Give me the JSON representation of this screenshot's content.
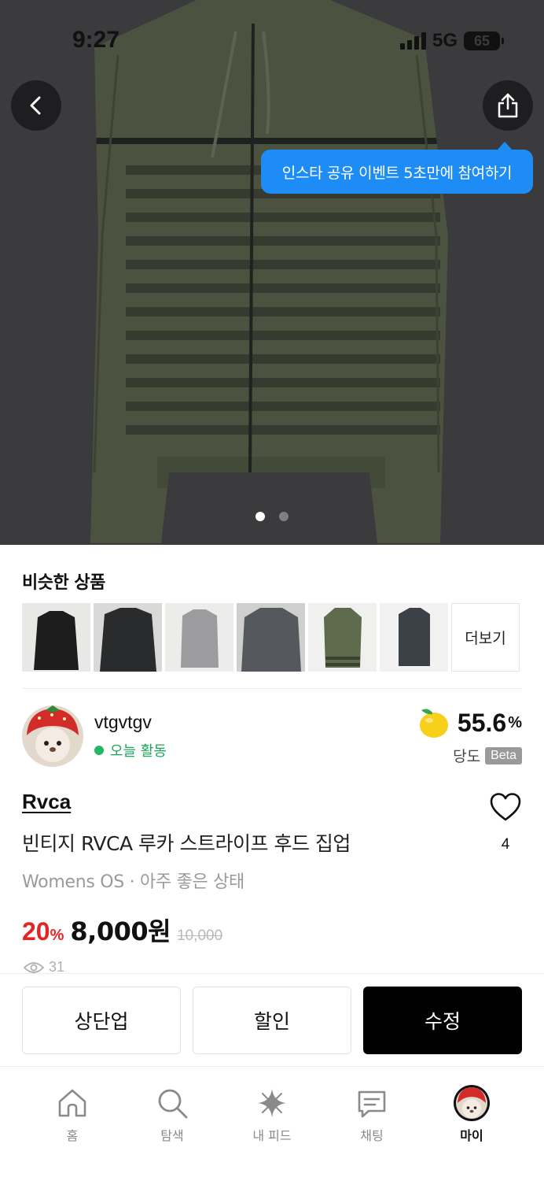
{
  "status_bar": {
    "time": "9:27",
    "network": "5G",
    "battery": "65"
  },
  "hero": {
    "tooltip": "인스타 공유 이벤트 5초만에 참여하기",
    "image_count": 2,
    "active_index": 0
  },
  "similar": {
    "title": "비슷한 상품",
    "more_label": "더보기"
  },
  "seller": {
    "username": "vtgvtgv",
    "activity": "오늘 활동",
    "score": "55.6",
    "score_unit": "%",
    "score_label": "당도",
    "badge": "Beta"
  },
  "product": {
    "brand": "Rvca",
    "title": "빈티지 RVCA 루카 스트라이프 후드 집업",
    "meta": "Womens OS · 아주 좋은 상태",
    "discount_value": "20",
    "discount_unit": "%",
    "price": "8,000원",
    "original_price": "10,000",
    "views": "31",
    "likes": "4"
  },
  "actions": {
    "bump": "상단업",
    "discount": "할인",
    "edit": "수정"
  },
  "tabs": [
    {
      "label": "홈",
      "icon": "home-icon"
    },
    {
      "label": "탐색",
      "icon": "search-icon"
    },
    {
      "label": "내 피드",
      "icon": "sparkle-icon"
    },
    {
      "label": "채팅",
      "icon": "chat-icon"
    },
    {
      "label": "마이",
      "icon": "profile-avatar"
    }
  ],
  "colors": {
    "tooltip": "#1e8cf5",
    "discount": "#e32424",
    "online": "#22b863",
    "primary_button": "#000000"
  }
}
